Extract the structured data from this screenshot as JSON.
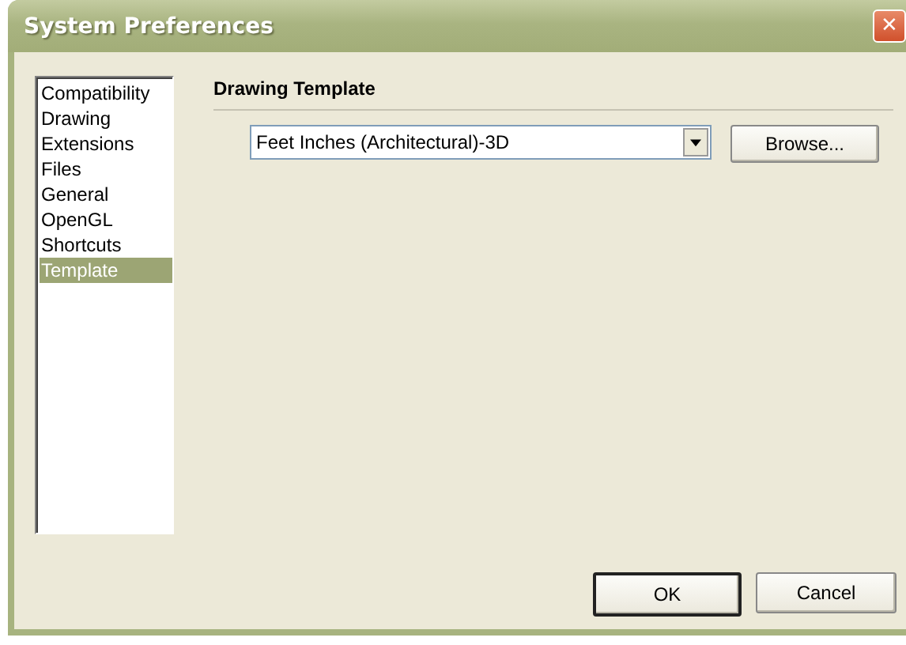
{
  "window": {
    "title": "System Preferences",
    "close": "✕"
  },
  "sidebar": {
    "items": [
      {
        "label": "Compatibility",
        "selected": false
      },
      {
        "label": "Drawing",
        "selected": false
      },
      {
        "label": "Extensions",
        "selected": false
      },
      {
        "label": "Files",
        "selected": false
      },
      {
        "label": "General",
        "selected": false
      },
      {
        "label": "OpenGL",
        "selected": false
      },
      {
        "label": "Shortcuts",
        "selected": false
      },
      {
        "label": "Template",
        "selected": true
      }
    ]
  },
  "section": {
    "heading": "Drawing Template",
    "template": {
      "value": "Feet Inches (Architectural)-3D"
    },
    "browse": "Browse..."
  },
  "buttons": [
    {
      "label": "OK",
      "default": true
    },
    {
      "label": "Cancel",
      "default": false
    }
  ]
}
